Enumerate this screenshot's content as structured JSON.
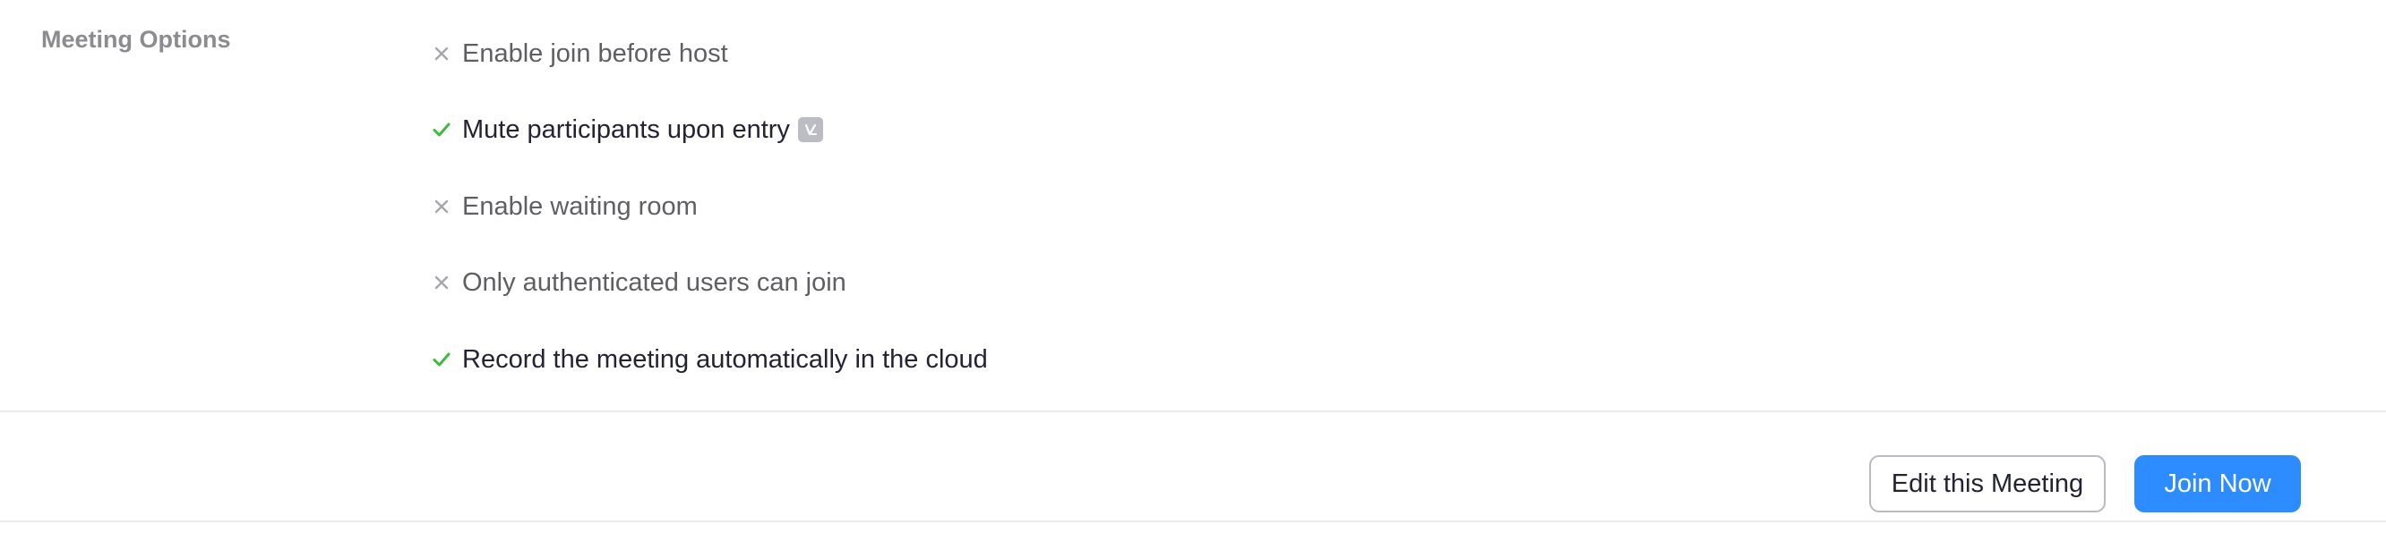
{
  "meeting_options": {
    "label": "Meeting Options",
    "items": [
      {
        "label": "Enable join before host",
        "enabled": false,
        "icon": "x-icon"
      },
      {
        "label": "Mute participants upon entry",
        "enabled": true,
        "icon": "check-icon",
        "info_icon": "info-badge-icon"
      },
      {
        "label": "Enable waiting room",
        "enabled": false,
        "icon": "x-icon"
      },
      {
        "label": "Only authenticated users can join",
        "enabled": false,
        "icon": "x-icon"
      },
      {
        "label": "Record the meeting automatically in the cloud",
        "enabled": true,
        "icon": "check-icon"
      }
    ]
  },
  "actions": {
    "edit_label": "Edit this Meeting",
    "join_label": "Join Now"
  },
  "colors": {
    "check": "#3dbb3d",
    "x": "#a6a6ac",
    "primary": "#2d8cff",
    "label_muted": "#8c8c90",
    "divider": "#ececf0"
  }
}
